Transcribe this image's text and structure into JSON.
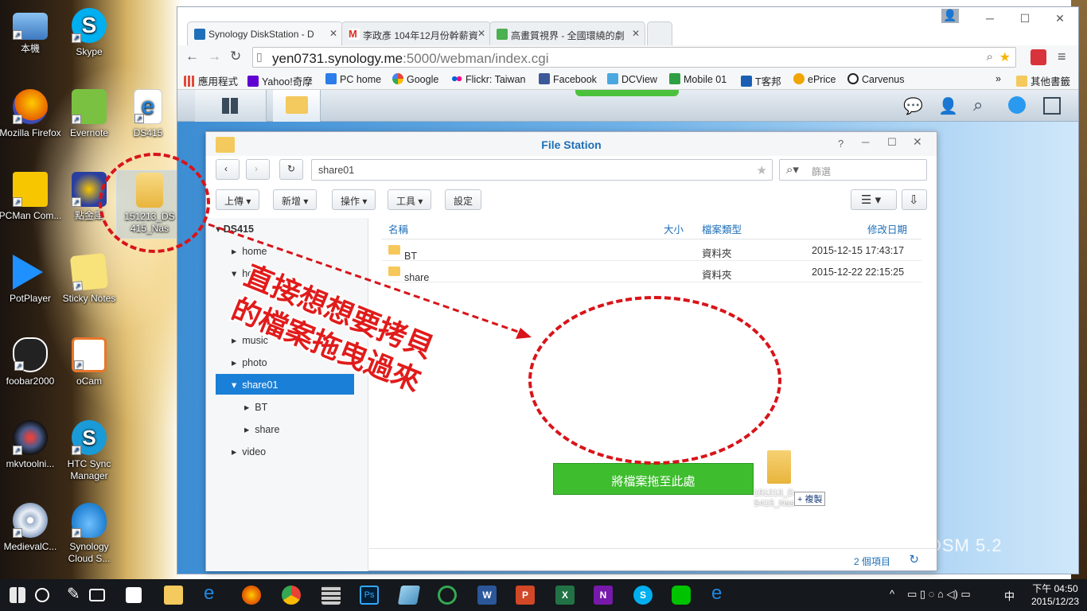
{
  "desktop": {
    "icons": [
      {
        "label": "本機",
        "icon": "computer-icon",
        "color": "#5aa0e0"
      },
      {
        "label": "Skype",
        "icon": "skype-icon",
        "color": "#00aff0"
      },
      {
        "label": "Mozilla Firefox",
        "icon": "firefox-icon",
        "color": "#e66000"
      },
      {
        "label": "Evernote",
        "icon": "evernote-icon",
        "color": "#7ac142"
      },
      {
        "label": "DS415",
        "icon": "ie-shortcut-icon",
        "color": "#1e88e5"
      },
      {
        "label": "PCMan Com...",
        "icon": "pcman-icon",
        "color": "#f7c600"
      },
      {
        "label": "點金庫",
        "icon": "gold-app-icon",
        "color": "#2a3fa0"
      },
      {
        "label": "151213_DS415_Nas",
        "icon": "folder-icon",
        "color": "#f4c95d"
      },
      {
        "label": "PotPlayer",
        "icon": "potplayer-icon",
        "color": "#1e90ff"
      },
      {
        "label": "Sticky Notes",
        "icon": "sticky-notes-icon",
        "color": "#f8e27a"
      },
      {
        "label": "foobar2000",
        "icon": "foobar-icon",
        "color": "#222222"
      },
      {
        "label": "oCam",
        "icon": "ocam-icon",
        "color": "#e9762b"
      },
      {
        "label": "mkvtoolni...",
        "icon": "mkvtoolnix-icon",
        "color": "#4a5a8a"
      },
      {
        "label": "HTC Sync Manager",
        "icon": "htc-sync-icon",
        "color": "#1a9bd7"
      },
      {
        "label": "MedievalC...",
        "icon": "cd-cue-icon",
        "color": "#cfd6e0"
      },
      {
        "label": "Synology Cloud S...",
        "icon": "cloud-icon",
        "color": "#3aa0e8"
      }
    ],
    "annotation": {
      "line1": "直接想想要拷貝",
      "line2": "的檔案拖曳過來",
      "color": "#e11b1b"
    }
  },
  "browser": {
    "tabs": [
      {
        "title": "Synology DiskStation - D",
        "icon": "dsm-favicon",
        "color": "#1e6fb8"
      },
      {
        "title": "李政彥 104年12月份幹薪資",
        "icon": "gmail-favicon",
        "color": "#d93025"
      },
      {
        "title": "高畫質視界 - 全國環繞的劇",
        "icon": "site-favicon",
        "color": "#4caf50"
      }
    ],
    "url_host": "yen0731.synology.me",
    "url_path": ":5000/webman/index.cgi",
    "bookmarks": [
      {
        "label": "應用程式",
        "icon": "apps-icon",
        "color": "#e04a3a"
      },
      {
        "label": "Yahoo!奇摩",
        "icon": "yahoo-icon",
        "color": "#5f01d1"
      },
      {
        "label": "PC home",
        "icon": "pchome-icon",
        "color": "#2b7de9"
      },
      {
        "label": "Google",
        "icon": "google-icon",
        "color": "#4285f4"
      },
      {
        "label": "Flickr: Taiwan",
        "icon": "flickr-icon",
        "color": "#ff0084"
      },
      {
        "label": "Facebook",
        "icon": "facebook-icon",
        "color": "#3b5998"
      },
      {
        "label": "DCView",
        "icon": "dcview-icon",
        "color": "#4aa8e0"
      },
      {
        "label": "Mobile 01",
        "icon": "mobile01-icon",
        "color": "#2ea043"
      },
      {
        "label": "T客邦",
        "icon": "tkb-icon",
        "color": "#1a5fb4"
      },
      {
        "label": "ePrice",
        "icon": "eprice-icon",
        "color": "#f0a500"
      },
      {
        "label": "Carvenus",
        "icon": "carvenus-icon",
        "color": "#222222"
      },
      {
        "label": "其他書籤",
        "icon": "folder-icon",
        "color": "#f4c95d"
      }
    ]
  },
  "dsm": {
    "version_logo": "DSM 5.2",
    "file_station": {
      "title": "File Station",
      "path": "share01",
      "search_placeholder": "篩選",
      "toolbar": {
        "upload": "上傳",
        "create": "新增",
        "action": "操作",
        "tools": "工具",
        "settings": "設定"
      },
      "tree": {
        "root": "DS415",
        "items": [
          "home",
          "homes",
          "music",
          "photo",
          "share01",
          "BT",
          "share",
          "video"
        ]
      },
      "columns": {
        "name": "名稱",
        "size": "大小",
        "type": "檔案類型",
        "modified": "修改日期"
      },
      "rows": [
        {
          "name": "BT",
          "size": "",
          "type": "資料夾",
          "modified": "2015-12-15 17:43:17"
        },
        {
          "name": "share",
          "size": "",
          "type": "資料夾",
          "modified": "2015-12-22 22:15:25"
        }
      ],
      "drag_item": "151213_DS415_Nas",
      "copy_tip": "+ 複製",
      "drop_hint": "將檔案拖至此處",
      "footer_count": "2 個項目"
    }
  },
  "taskbar": {
    "time": "下午 04:50",
    "date": "2015/12/23",
    "ime": "中"
  }
}
